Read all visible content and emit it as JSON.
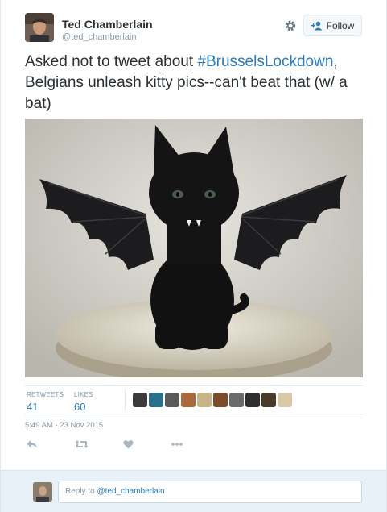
{
  "header": {
    "display_name": "Ted Chamberlain",
    "handle": "@ted_chamberlain",
    "follow_label": "Follow"
  },
  "tweet": {
    "text_before": "Asked not to tweet about ",
    "hashtag": "#BrusselsLockdown",
    "text_after": ", Belgians unleash kitty pics--can't beat that (w/ a bat)"
  },
  "stats": {
    "retweets_label": "RETWEETS",
    "retweets_count": "41",
    "likes_label": "LIKES",
    "likes_count": "60"
  },
  "likers": [
    {
      "color": "#3b3b3b"
    },
    {
      "color": "#2a6f8a"
    },
    {
      "color": "#5a5a5a"
    },
    {
      "color": "#a66a3c"
    },
    {
      "color": "#c9b48a"
    },
    {
      "color": "#7c4b2c"
    },
    {
      "color": "#6b6b6b"
    },
    {
      "color": "#2e2e2e"
    },
    {
      "color": "#4a3a2a"
    },
    {
      "color": "#d8c8a8"
    }
  ],
  "timestamp": "5:49 AM - 23 Nov 2015",
  "actions": {
    "icons": [
      "reply-icon",
      "retweet-icon",
      "like-icon",
      "more-icon"
    ]
  },
  "reply": {
    "prefix": "Reply to ",
    "mention": "@ted_chamberlain"
  },
  "colors": {
    "link": "#2b7bb9",
    "muted": "#8899a6",
    "text": "#292f33"
  }
}
